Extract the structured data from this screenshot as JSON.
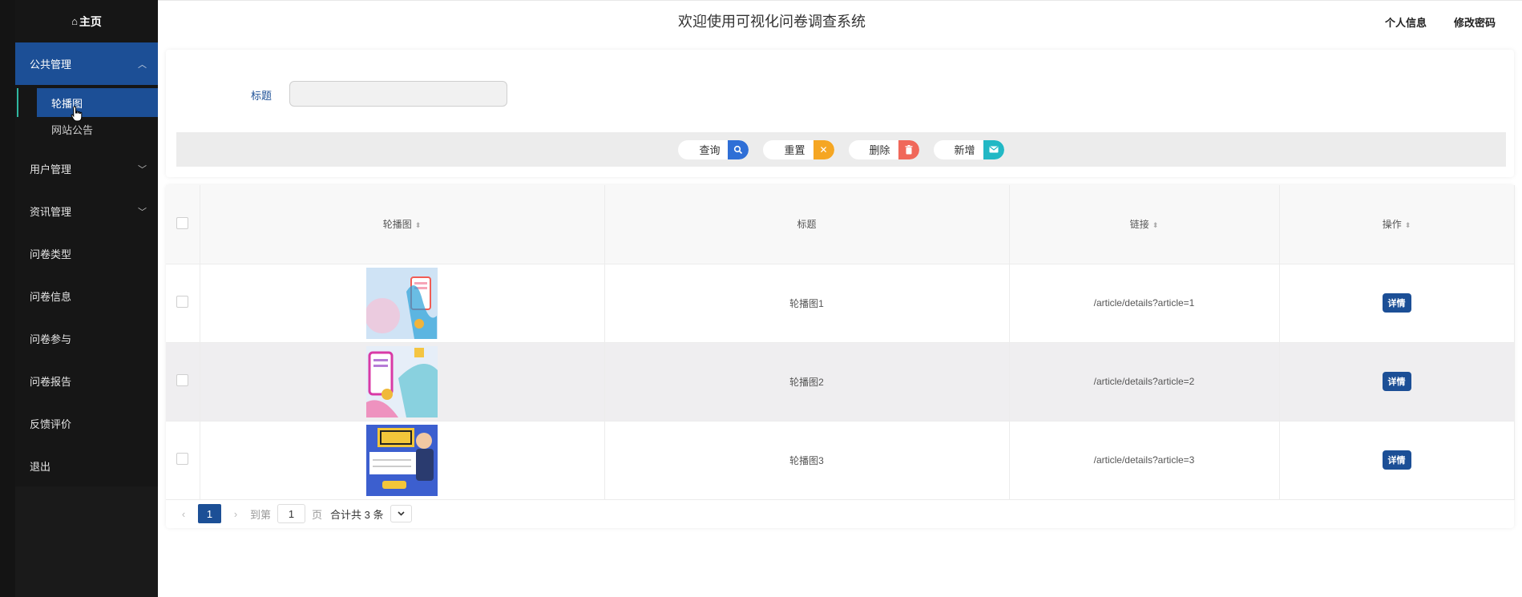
{
  "sidebar": {
    "home_label": "主页",
    "group_label": "公共管理",
    "active_sub": "轮播图",
    "sub_item": "网站公告",
    "items": [
      {
        "label": "用户管理",
        "has_chevron": true
      },
      {
        "label": "资讯管理",
        "has_chevron": true
      },
      {
        "label": "问卷类型"
      },
      {
        "label": "问卷信息"
      },
      {
        "label": "问卷参与"
      },
      {
        "label": "问卷报告"
      },
      {
        "label": "反馈评价"
      },
      {
        "label": "退出"
      }
    ]
  },
  "header": {
    "title": "欢迎使用可视化问卷调查系统",
    "profile": "个人信息",
    "password": "修改密码"
  },
  "search": {
    "label": "标题",
    "value": "",
    "buttons": {
      "query": "查询",
      "reset": "重置",
      "delete": "删除",
      "add": "新增"
    },
    "colors": {
      "query": "#2f6fd6",
      "reset": "#f5a623",
      "delete": "#f0685a",
      "add": "#22b8c5"
    }
  },
  "table": {
    "headers": {
      "image": "轮播图",
      "title": "标题",
      "link": "链接",
      "action": "操作"
    },
    "rows": [
      {
        "title": "轮播图1",
        "link": "/article/details?article=1",
        "action": "详情"
      },
      {
        "title": "轮播图2",
        "link": "/article/details?article=2",
        "action": "详情"
      },
      {
        "title": "轮播图3",
        "link": "/article/details?article=3",
        "action": "详情"
      }
    ]
  },
  "pagination": {
    "current": "1",
    "goto_label": "到第",
    "page_value": "1",
    "page_suffix": "页",
    "total": "合计共 3 条"
  },
  "colors": {
    "accent": "#1c4f96",
    "sidebar_bg": "#161616"
  }
}
